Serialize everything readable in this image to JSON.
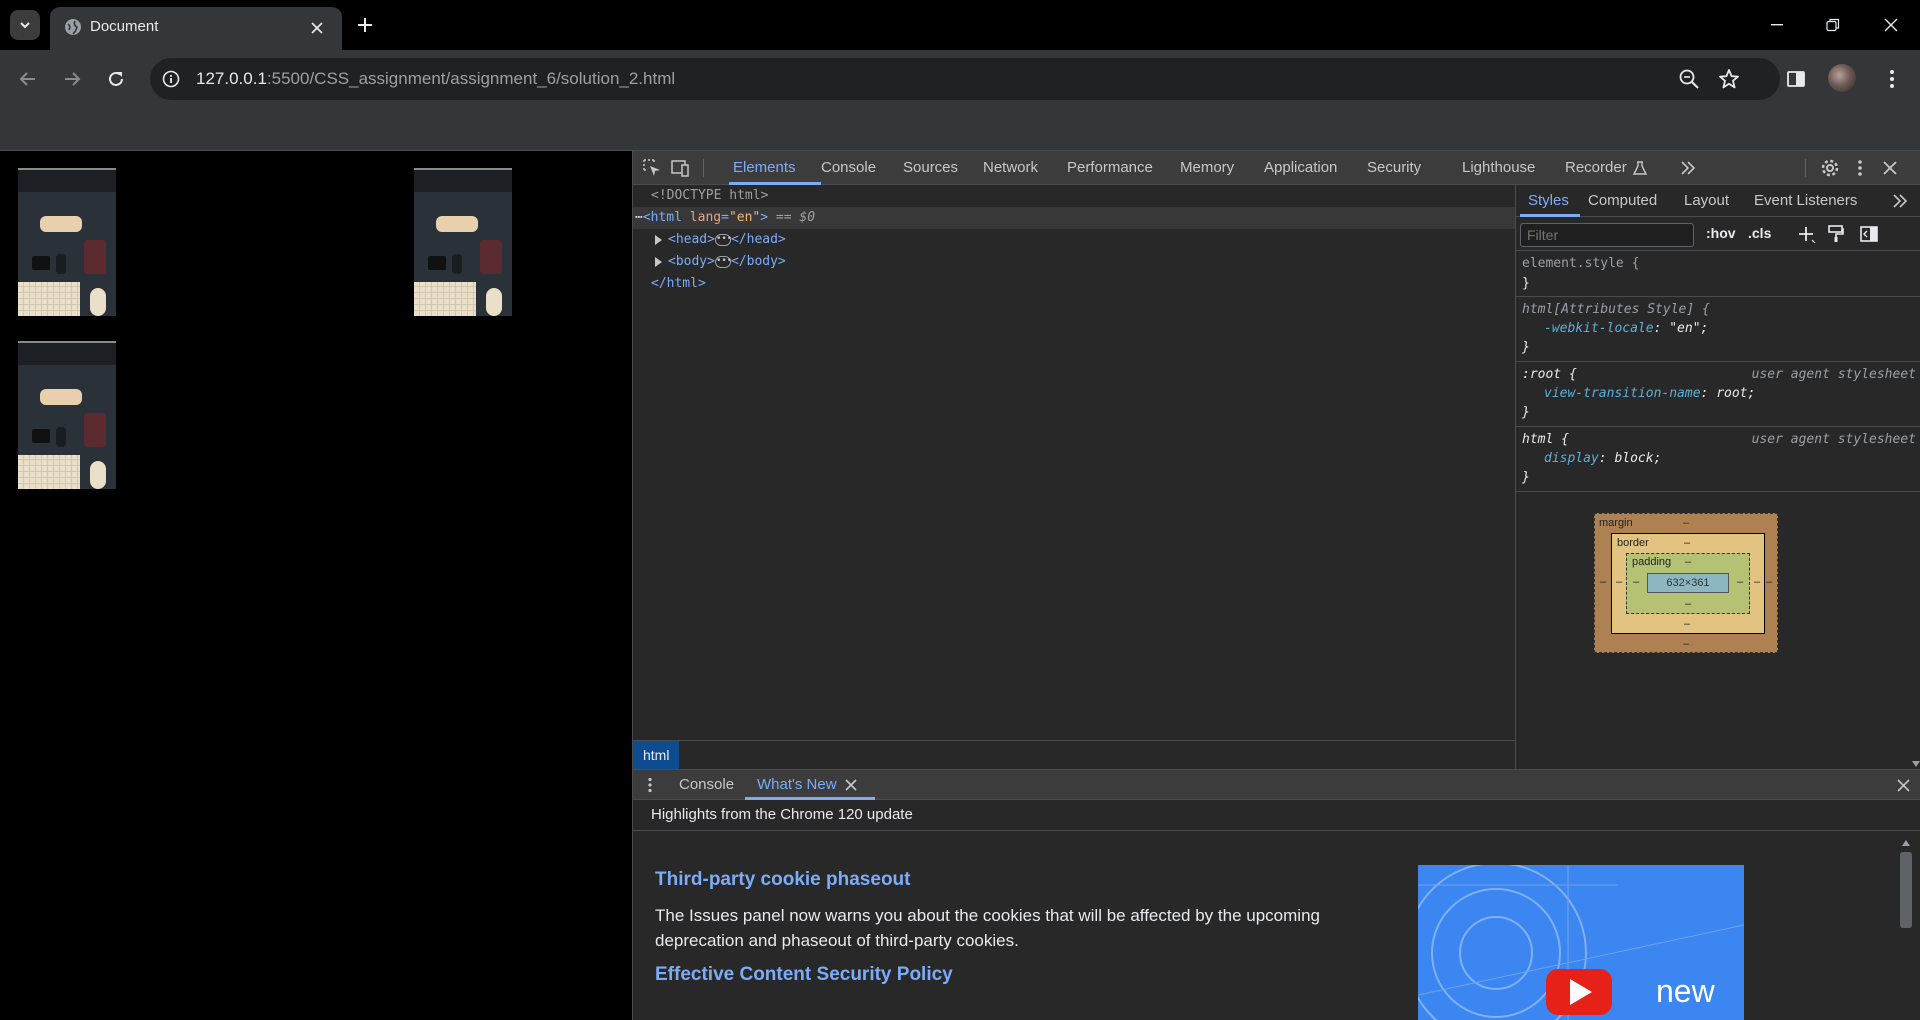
{
  "browser": {
    "tab_title": "Document",
    "url_host": "127.0.0.1",
    "url_rest": ":5500/CSS_assignment/assignment_6/solution_2.html"
  },
  "devtools": {
    "tabs": [
      "Elements",
      "Console",
      "Sources",
      "Network",
      "Performance",
      "Memory",
      "Application",
      "Security",
      "Lighthouse",
      "Recorder"
    ],
    "active_tab": "Elements",
    "dom": {
      "doctype": "<!DOCTYPE html>",
      "html_open_tag": "<html",
      "html_attr_name": "lang",
      "html_attr_value": "\"en\"",
      "html_close_bracket": ">",
      "selected_marker": "== $0",
      "head_open": "<head>",
      "head_close": "</head>",
      "body_open": "<body>",
      "body_close": "</body>",
      "html_close": "</html>"
    },
    "breadcrumb": "html",
    "styles_tabs": [
      "Styles",
      "Computed",
      "Layout",
      "Event Listeners"
    ],
    "filter_placeholder": "Filter",
    "filter_hov": ":hov",
    "filter_cls": ".cls",
    "rules": [
      {
        "selector": "element.style {",
        "source": "",
        "props": [],
        "close": "}"
      },
      {
        "selector": "html[Attributes Style] {",
        "source": "",
        "props": [
          {
            "name": "-webkit-locale",
            "value": "\"en\";"
          }
        ],
        "close": "}"
      },
      {
        "selector": ":root {",
        "source": "user agent stylesheet",
        "props": [
          {
            "name": "view-transition-name",
            "value": "root;"
          }
        ],
        "close": "}"
      },
      {
        "selector": "html {",
        "source": "user agent stylesheet",
        "props": [
          {
            "name": "display",
            "value": "block;"
          }
        ],
        "close": "}"
      }
    ],
    "box_model": {
      "margin_label": "margin",
      "border_label": "border",
      "padding_label": "padding",
      "dash": "–",
      "content_size": "632×361"
    },
    "drawer": {
      "tabs": [
        "Console",
        "What's New"
      ],
      "active_tab": "What's New",
      "highlights": "Highlights from the Chrome 120 update",
      "sections": [
        {
          "heading": "Third-party cookie phaseout",
          "body": "The Issues panel now warns you about the cookies that will be affected by the upcoming deprecation and phaseout of third-party cookies."
        },
        {
          "heading": "Effective Content Security Policy",
          "body": ""
        }
      ],
      "promo_text": "new"
    }
  }
}
